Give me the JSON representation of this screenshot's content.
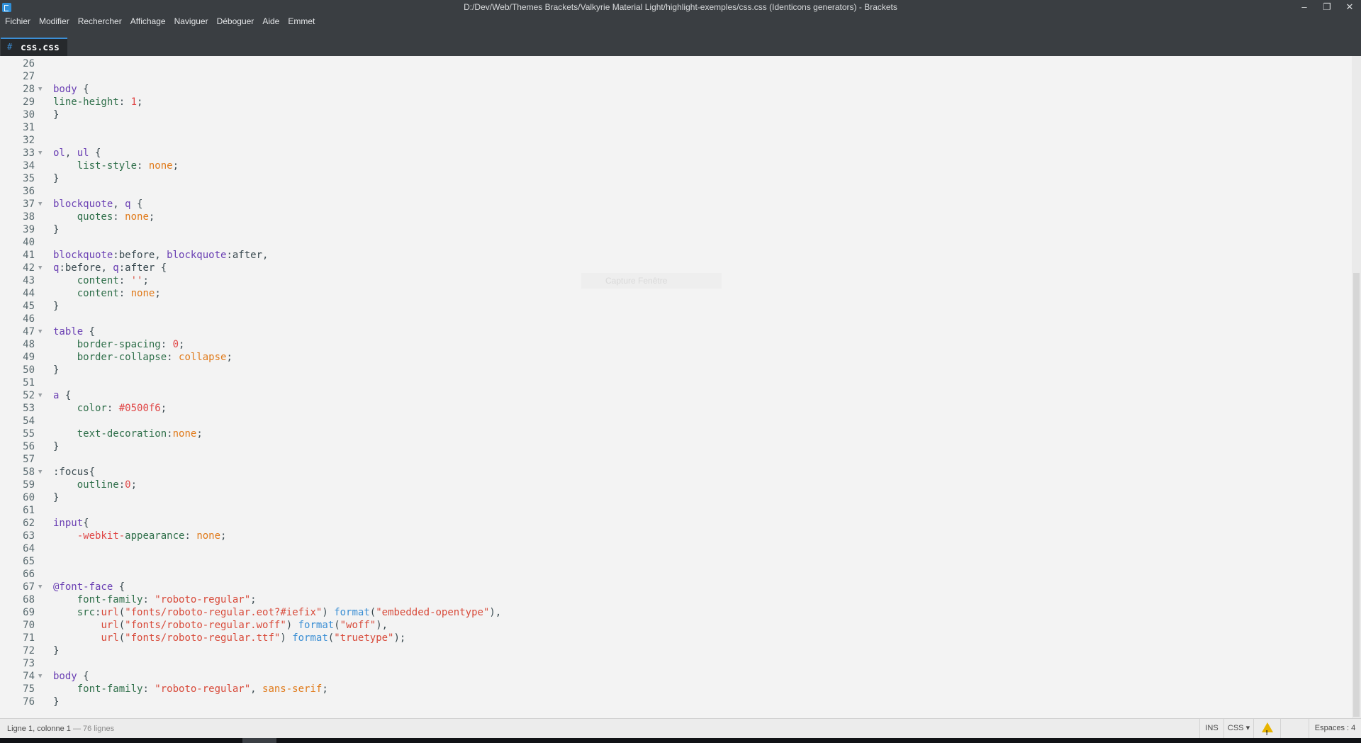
{
  "window": {
    "title": "D:/Dev/Web/Themes Brackets/Valkyrie Material Light/highlight-exemples/css.css (Identicons generators) - Brackets",
    "minimize_glyph": "–",
    "restore_glyph": "❐",
    "close_glyph": "✕"
  },
  "menu": [
    "Fichier",
    "Modifier",
    "Rechercher",
    "Affichage",
    "Naviguer",
    "Déboguer",
    "Aide",
    "Emmet"
  ],
  "tab": {
    "icon": "#",
    "filename": "css.css"
  },
  "overlay": {
    "text": "Capture Fenêtre"
  },
  "status": {
    "position": "Ligne 1, colonne 1",
    "line_count": " — 76 lignes",
    "mode": "INS",
    "language": "CSS ▾",
    "warning_icon": "warning-icon",
    "indent": "Espaces : 4"
  },
  "colors": {
    "accent": "#3c8fd6",
    "selector": "#6a3fb3",
    "property": "#2f6f4a",
    "value": "#e07a1a",
    "number": "#e04747",
    "string": "#d84a3a",
    "function": "#3b8fd4"
  },
  "code_lines": [
    {
      "n": "26",
      "fold": false,
      "tokens": []
    },
    {
      "n": "27",
      "fold": false,
      "tokens": []
    },
    {
      "n": "28",
      "fold": true,
      "tokens": [
        [
          "sel",
          "body"
        ],
        [
          "punc",
          " {"
        ]
      ]
    },
    {
      "n": "29",
      "fold": false,
      "tokens": [
        [
          "prop",
          "line-height"
        ],
        [
          "punc",
          ": "
        ],
        [
          "num",
          "1"
        ],
        [
          "punc",
          ";"
        ]
      ]
    },
    {
      "n": "30",
      "fold": false,
      "tokens": [
        [
          "punc",
          "}"
        ]
      ]
    },
    {
      "n": "31",
      "fold": false,
      "tokens": []
    },
    {
      "n": "32",
      "fold": false,
      "tokens": []
    },
    {
      "n": "33",
      "fold": true,
      "tokens": [
        [
          "sel",
          "ol"
        ],
        [
          "punc",
          ", "
        ],
        [
          "sel",
          "ul"
        ],
        [
          "punc",
          " {"
        ]
      ]
    },
    {
      "n": "34",
      "fold": false,
      "tokens": [
        [
          "punc",
          "    "
        ],
        [
          "prop",
          "list-style"
        ],
        [
          "punc",
          ": "
        ],
        [
          "val",
          "none"
        ],
        [
          "punc",
          ";"
        ]
      ]
    },
    {
      "n": "35",
      "fold": false,
      "tokens": [
        [
          "punc",
          "}"
        ]
      ]
    },
    {
      "n": "36",
      "fold": false,
      "tokens": []
    },
    {
      "n": "37",
      "fold": true,
      "tokens": [
        [
          "sel",
          "blockquote"
        ],
        [
          "punc",
          ", "
        ],
        [
          "sel",
          "q"
        ],
        [
          "punc",
          " {"
        ]
      ]
    },
    {
      "n": "38",
      "fold": false,
      "tokens": [
        [
          "punc",
          "    "
        ],
        [
          "prop",
          "quotes"
        ],
        [
          "punc",
          ": "
        ],
        [
          "val",
          "none"
        ],
        [
          "punc",
          ";"
        ]
      ]
    },
    {
      "n": "39",
      "fold": false,
      "tokens": [
        [
          "punc",
          "}"
        ]
      ]
    },
    {
      "n": "40",
      "fold": false,
      "tokens": []
    },
    {
      "n": "41",
      "fold": false,
      "tokens": [
        [
          "sel",
          "blockquote"
        ],
        [
          "punc",
          ":before, "
        ],
        [
          "sel",
          "blockquote"
        ],
        [
          "punc",
          ":after,"
        ]
      ]
    },
    {
      "n": "42",
      "fold": true,
      "tokens": [
        [
          "sel",
          "q"
        ],
        [
          "punc",
          ":before, "
        ],
        [
          "sel",
          "q"
        ],
        [
          "punc",
          ":after {"
        ]
      ]
    },
    {
      "n": "43",
      "fold": false,
      "tokens": [
        [
          "punc",
          "    "
        ],
        [
          "prop",
          "content"
        ],
        [
          "punc",
          ": "
        ],
        [
          "str",
          "''"
        ],
        [
          "punc",
          ";"
        ]
      ]
    },
    {
      "n": "44",
      "fold": false,
      "tokens": [
        [
          "punc",
          "    "
        ],
        [
          "prop",
          "content"
        ],
        [
          "punc",
          ": "
        ],
        [
          "val",
          "none"
        ],
        [
          "punc",
          ";"
        ]
      ]
    },
    {
      "n": "45",
      "fold": false,
      "tokens": [
        [
          "punc",
          "}"
        ]
      ]
    },
    {
      "n": "46",
      "fold": false,
      "tokens": []
    },
    {
      "n": "47",
      "fold": true,
      "tokens": [
        [
          "sel",
          "table"
        ],
        [
          "punc",
          " {"
        ]
      ]
    },
    {
      "n": "48",
      "fold": false,
      "tokens": [
        [
          "punc",
          "    "
        ],
        [
          "prop",
          "border-spacing"
        ],
        [
          "punc",
          ": "
        ],
        [
          "num",
          "0"
        ],
        [
          "punc",
          ";"
        ]
      ]
    },
    {
      "n": "49",
      "fold": false,
      "tokens": [
        [
          "punc",
          "    "
        ],
        [
          "prop",
          "border-collapse"
        ],
        [
          "punc",
          ": "
        ],
        [
          "val",
          "collapse"
        ],
        [
          "punc",
          ";"
        ]
      ]
    },
    {
      "n": "50",
      "fold": false,
      "tokens": [
        [
          "punc",
          "}"
        ]
      ]
    },
    {
      "n": "51",
      "fold": false,
      "tokens": []
    },
    {
      "n": "52",
      "fold": true,
      "tokens": [
        [
          "sel",
          "a"
        ],
        [
          "punc",
          " {"
        ]
      ]
    },
    {
      "n": "53",
      "fold": false,
      "tokens": [
        [
          "punc",
          "    "
        ],
        [
          "prop",
          "color"
        ],
        [
          "punc",
          ": "
        ],
        [
          "num",
          "#0500f6"
        ],
        [
          "punc",
          ";"
        ]
      ]
    },
    {
      "n": "54",
      "fold": false,
      "tokens": []
    },
    {
      "n": "55",
      "fold": false,
      "tokens": [
        [
          "punc",
          "    "
        ],
        [
          "prop",
          "text-decoration"
        ],
        [
          "punc",
          ":"
        ],
        [
          "val",
          "none"
        ],
        [
          "punc",
          ";"
        ]
      ]
    },
    {
      "n": "56",
      "fold": false,
      "tokens": [
        [
          "punc",
          "}"
        ]
      ]
    },
    {
      "n": "57",
      "fold": false,
      "tokens": []
    },
    {
      "n": "58",
      "fold": true,
      "tokens": [
        [
          "punc",
          ":focus{"
        ]
      ]
    },
    {
      "n": "59",
      "fold": false,
      "tokens": [
        [
          "punc",
          "    "
        ],
        [
          "prop",
          "outline"
        ],
        [
          "punc",
          ":"
        ],
        [
          "num",
          "0"
        ],
        [
          "punc",
          ";"
        ]
      ]
    },
    {
      "n": "60",
      "fold": false,
      "tokens": [
        [
          "punc",
          "}"
        ]
      ]
    },
    {
      "n": "61",
      "fold": false,
      "tokens": []
    },
    {
      "n": "62",
      "fold": false,
      "tokens": [
        [
          "sel",
          "input"
        ],
        [
          "punc",
          "{"
        ]
      ]
    },
    {
      "n": "63",
      "fold": false,
      "tokens": [
        [
          "punc",
          "    "
        ],
        [
          "num",
          "-webkit-"
        ],
        [
          "prop",
          "appearance"
        ],
        [
          "punc",
          ": "
        ],
        [
          "val",
          "none"
        ],
        [
          "punc",
          ";"
        ]
      ]
    },
    {
      "n": "64",
      "fold": false,
      "tokens": []
    },
    {
      "n": "65",
      "fold": false,
      "tokens": []
    },
    {
      "n": "66",
      "fold": false,
      "tokens": []
    },
    {
      "n": "67",
      "fold": true,
      "tokens": [
        [
          "at",
          "@font-face"
        ],
        [
          "punc",
          " {"
        ]
      ]
    },
    {
      "n": "68",
      "fold": false,
      "tokens": [
        [
          "punc",
          "    "
        ],
        [
          "prop",
          "font-family"
        ],
        [
          "punc",
          ": "
        ],
        [
          "str",
          "\"roboto-regular\""
        ],
        [
          "punc",
          ";"
        ]
      ]
    },
    {
      "n": "69",
      "fold": false,
      "tokens": [
        [
          "punc",
          "    "
        ],
        [
          "prop",
          "src"
        ],
        [
          "punc",
          ":"
        ],
        [
          "str",
          "url"
        ],
        [
          "punc",
          "("
        ],
        [
          "str",
          "\"fonts/roboto-regular.eot?#iefix\""
        ],
        [
          "punc",
          ") "
        ],
        [
          "fn",
          "format"
        ],
        [
          "punc",
          "("
        ],
        [
          "str",
          "\"embedded-opentype\""
        ],
        [
          "punc",
          "),"
        ]
      ]
    },
    {
      "n": "70",
      "fold": false,
      "tokens": [
        [
          "punc",
          "        "
        ],
        [
          "str",
          "url"
        ],
        [
          "punc",
          "("
        ],
        [
          "str",
          "\"fonts/roboto-regular.woff\""
        ],
        [
          "punc",
          ") "
        ],
        [
          "fn",
          "format"
        ],
        [
          "punc",
          "("
        ],
        [
          "str",
          "\"woff\""
        ],
        [
          "punc",
          "),"
        ]
      ]
    },
    {
      "n": "71",
      "fold": false,
      "tokens": [
        [
          "punc",
          "        "
        ],
        [
          "str",
          "url"
        ],
        [
          "punc",
          "("
        ],
        [
          "str",
          "\"fonts/roboto-regular.ttf\""
        ],
        [
          "punc",
          ") "
        ],
        [
          "fn",
          "format"
        ],
        [
          "punc",
          "("
        ],
        [
          "str",
          "\"truetype\""
        ],
        [
          "punc",
          ");"
        ]
      ]
    },
    {
      "n": "72",
      "fold": false,
      "tokens": [
        [
          "punc",
          "}"
        ]
      ]
    },
    {
      "n": "73",
      "fold": false,
      "tokens": []
    },
    {
      "n": "74",
      "fold": true,
      "tokens": [
        [
          "sel",
          "body"
        ],
        [
          "punc",
          " {"
        ]
      ]
    },
    {
      "n": "75",
      "fold": false,
      "tokens": [
        [
          "punc",
          "    "
        ],
        [
          "prop",
          "font-family"
        ],
        [
          "punc",
          ": "
        ],
        [
          "str",
          "\"roboto-regular\""
        ],
        [
          "punc",
          ", "
        ],
        [
          "val",
          "sans-serif"
        ],
        [
          "punc",
          ";"
        ]
      ]
    },
    {
      "n": "76",
      "fold": false,
      "tokens": [
        [
          "punc",
          "}"
        ]
      ]
    }
  ]
}
